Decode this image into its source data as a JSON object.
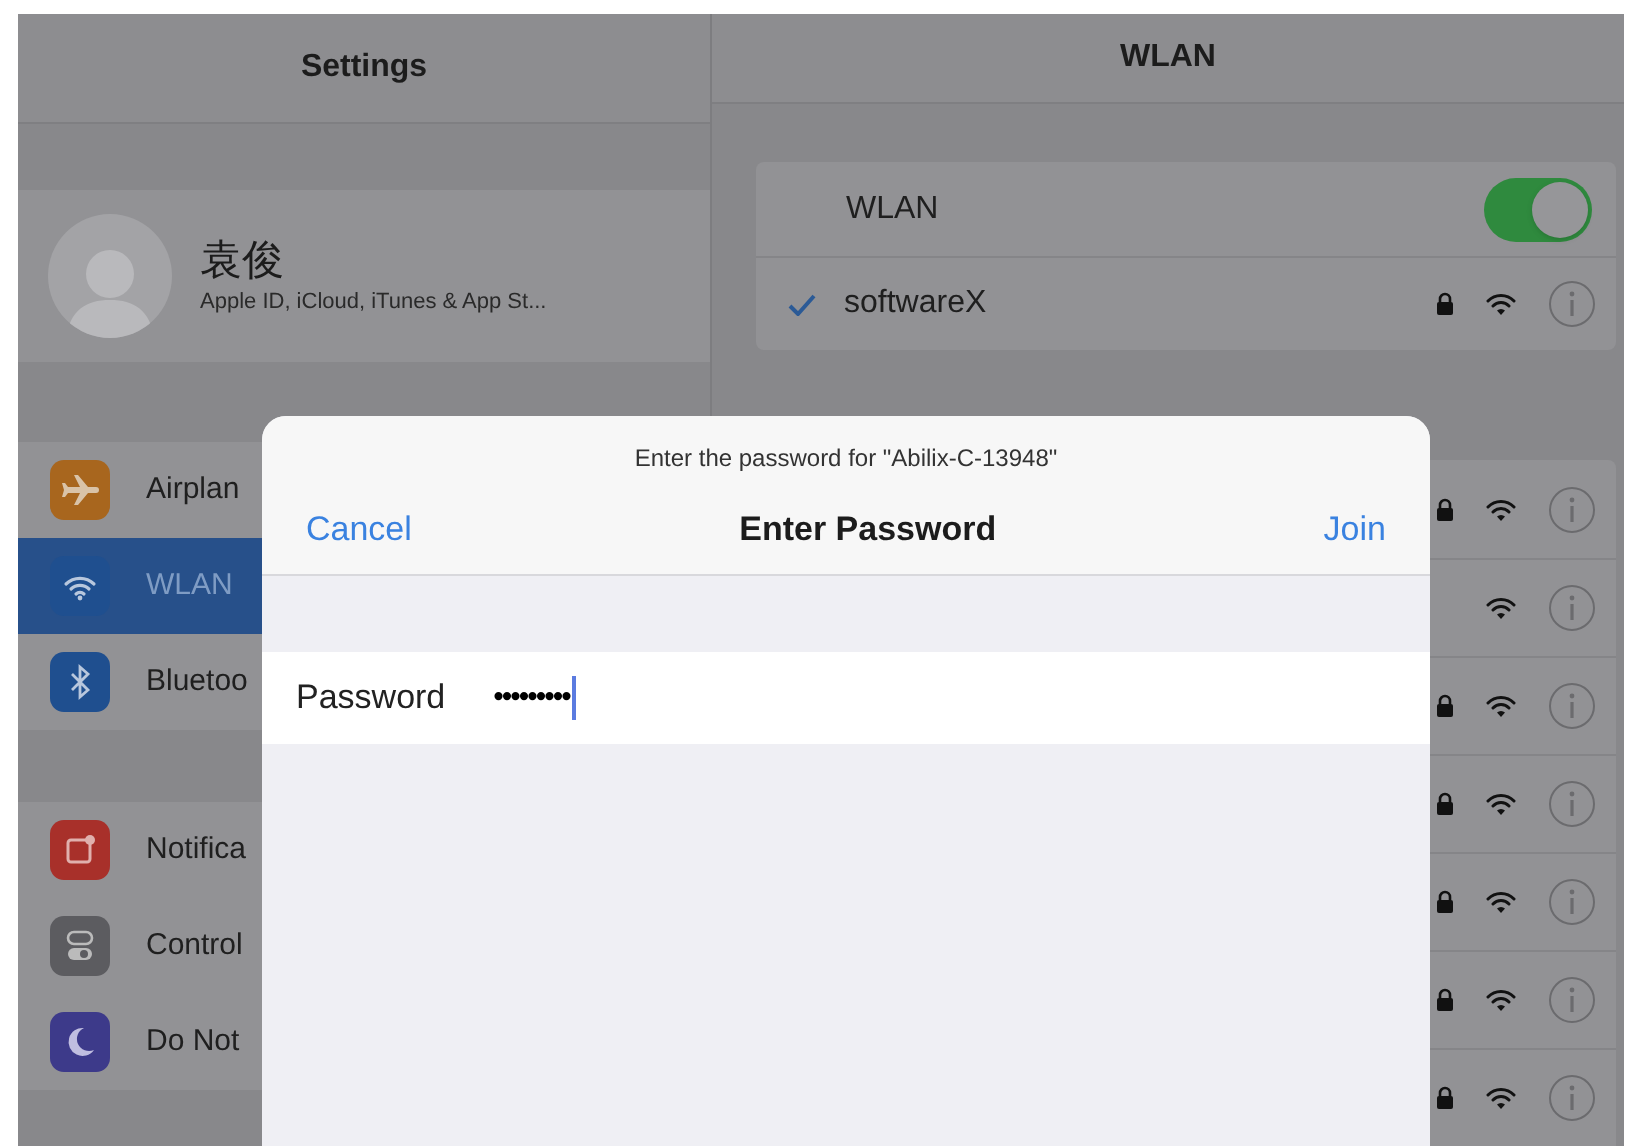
{
  "settings_header": {
    "title": "Settings"
  },
  "profile": {
    "name": "袁俊",
    "subtitle": "Apple ID, iCloud, iTunes & App St..."
  },
  "sidebar": {
    "groups": [
      [
        {
          "label": "Airplan",
          "kind": "airplane",
          "color": "#a8661e",
          "selected": false
        },
        {
          "label": "WLAN",
          "kind": "wifi",
          "color": "#1f4f8f",
          "selected": true
        },
        {
          "label": "Bluetoo",
          "kind": "bluetooth",
          "color": "#1f4f8f",
          "selected": false
        }
      ],
      [
        {
          "label": "Notifica",
          "kind": "notifications",
          "color": "#a8302a",
          "selected": false
        },
        {
          "label": "Control",
          "kind": "control",
          "color": "#5c5c60",
          "selected": false
        },
        {
          "label": "Do Not",
          "kind": "moon",
          "color": "#3d3a8a",
          "selected": false
        }
      ]
    ]
  },
  "wlan_header": {
    "title": "WLAN"
  },
  "wlan": {
    "label": "WLAN",
    "on": true
  },
  "current_network": {
    "name": "softwareX",
    "connected": true,
    "locked": true
  },
  "networks": [
    {
      "locked": true
    },
    {
      "locked": false
    },
    {
      "locked": true
    },
    {
      "locked": true
    },
    {
      "locked": true
    },
    {
      "locked": true
    },
    {
      "locked": true
    }
  ],
  "dialog": {
    "prompt": "Enter the password for \"Abilix-C-13948\"",
    "cancel": "Cancel",
    "title": "Enter Password",
    "join": "Join",
    "field_label": "Password",
    "value": "•••••••••"
  }
}
